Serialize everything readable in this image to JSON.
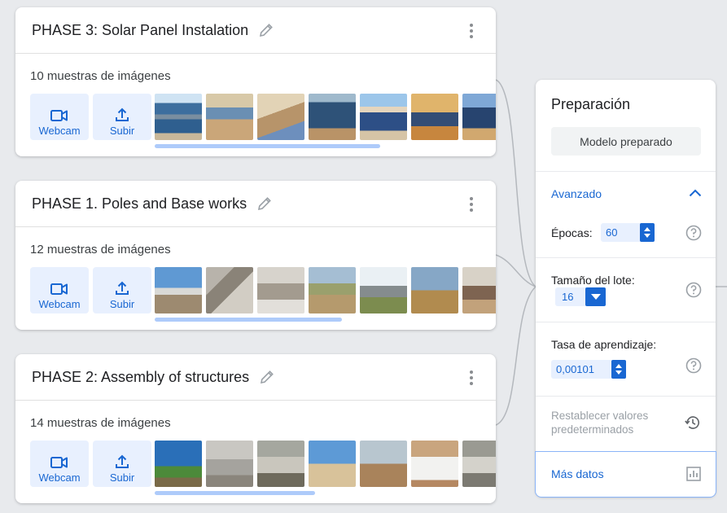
{
  "cards": [
    {
      "title": "PHASE 3: Solar Panel Instalation",
      "sample_count": "10 muestras de imágenes",
      "webcam_label": "Webcam",
      "upload_label": "Subir",
      "scroll_fraction": 0.66
    },
    {
      "title": "PHASE 1. Poles and Base works",
      "sample_count": "12 muestras de imágenes",
      "webcam_label": "Webcam",
      "upload_label": "Subir",
      "scroll_fraction": 0.55
    },
    {
      "title": "PHASE 2: Assembly of structures",
      "sample_count": "14 muestras de imágenes",
      "webcam_label": "Webcam",
      "upload_label": "Subir",
      "scroll_fraction": 0.47
    }
  ],
  "training": {
    "title": "Preparación",
    "train_button": "Modelo preparado",
    "advanced_label": "Avanzado",
    "epochs_label": "Épocas:",
    "epochs_value": "60",
    "batch_label": "Tamaño del lote:",
    "batch_value": "16",
    "lr_label": "Tasa de aprendizaje:",
    "lr_value": "0,00101",
    "reset_label": "Restablecer valores predeterminados",
    "more_data_label": "Más datos"
  },
  "colors": {
    "accent": "#1967d2",
    "accent_light": "#e8f0fe",
    "background": "#e8eaed",
    "scroll_thumb": "#aecbfa"
  }
}
